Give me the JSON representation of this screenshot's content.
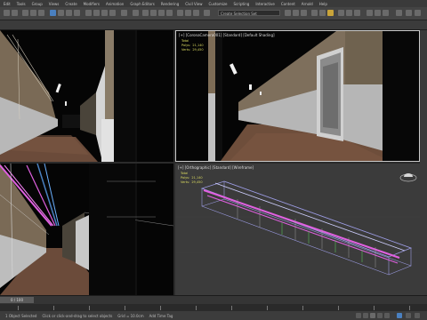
{
  "menu": [
    "Edit",
    "Tools",
    "Group",
    "Views",
    "Create",
    "Modifiers",
    "Animation",
    "Graph Editors",
    "Rendering",
    "Civil View",
    "Customize",
    "Scripting",
    "Interactive",
    "Content",
    "Arnold",
    "Help"
  ],
  "toolbar": {
    "selection_set_placeholder": "Create Selection Set"
  },
  "viewports": {
    "top_left": {
      "label": ""
    },
    "top_right": {
      "label": "[+] [CoronaCamera001] [Standard] [Default Shading]",
      "stats_label": "Total\nPolys:  21,140\nVerts:  29,450"
    },
    "bottom_left": {
      "label": ""
    },
    "bottom_right": {
      "label": "[+] [Orthographic] [Standard] [Wireframe]",
      "stats_label": "Total\nPolys:  21,140\nVerts:  29,450"
    }
  },
  "timeline": {
    "frame_readout": "0 / 100"
  },
  "status": {
    "left_text": "1 Object Selected",
    "prompt": "Click or click-and-drag to select objects",
    "grid": "Grid = 10.0cm",
    "add_time_tag": "Add Time Tag"
  },
  "colors": {
    "accent": "#4a80c0",
    "selection_frame": "#c9c9c9",
    "pipe_magenta": "#e060e0"
  }
}
